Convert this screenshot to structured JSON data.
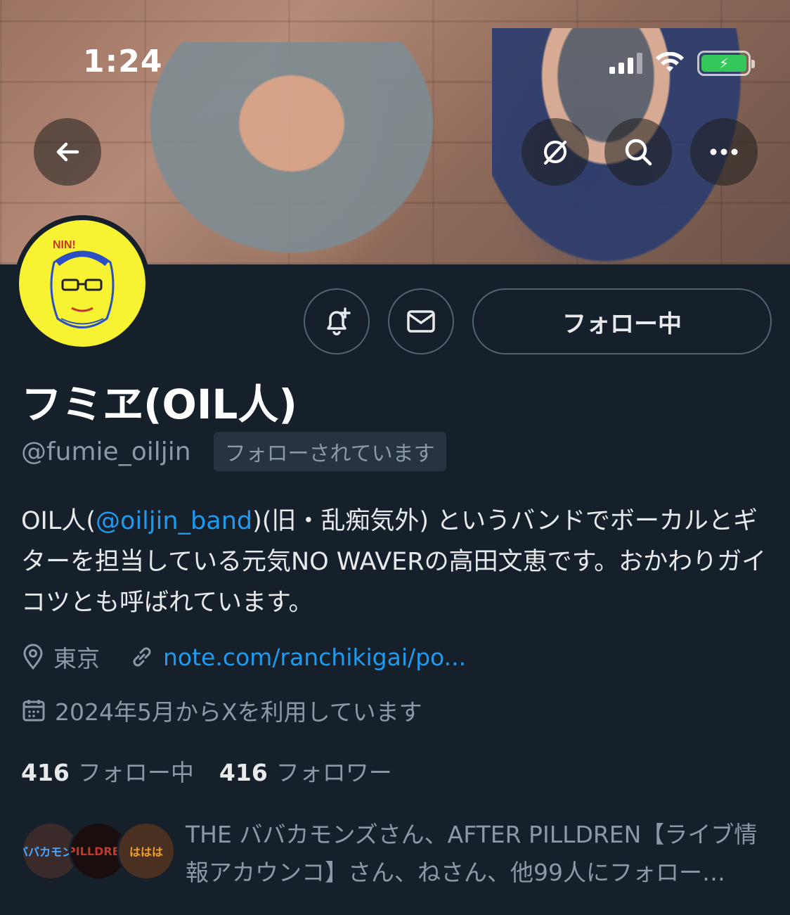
{
  "status_bar": {
    "time": "1:24"
  },
  "header": {
    "back_icon": "arrow-left-icon",
    "icons": [
      "grok-icon",
      "search-icon",
      "more-icon"
    ]
  },
  "profile": {
    "display_name": "フミヱ(OIL人)",
    "handle": "@fumie_oiljin",
    "follows_you_badge": "フォローされています",
    "avatar_text": "NIN!",
    "bio": {
      "part1": "OIL人(",
      "mention": "@oiljin_band",
      "part2": ")(旧・乱痴気外) というバンドでボーカルとギターを担当している元気NO WAVERの高田文恵です。おかわりガイコツとも呼ばれています。"
    },
    "location": "東京",
    "website": "note.com/ranchikigai/po...",
    "joined": "2024年5月からXを利用しています",
    "following_count": "416",
    "following_label": "フォロー中",
    "followers_count": "416",
    "followers_label": "フォロワー",
    "followers_you_know_text": "THE ババカモンズさん、AFTER PILLDREN【ライブ情報アカウンコ】さん、ねさん、他99人にフォロー…",
    "fyk_avatar_labels": [
      "ババカモンズ",
      "PILLDREN",
      "ははは"
    ]
  },
  "actions": {
    "notify_icon": "bell-plus-icon",
    "message_icon": "mail-icon",
    "follow_button": "フォロー中"
  },
  "colors": {
    "background": "#15202b",
    "accent": "#1d9bf0",
    "secondary_text": "#8b98a5",
    "battery": "#34c759",
    "avatar_bg": "#f7f232"
  }
}
